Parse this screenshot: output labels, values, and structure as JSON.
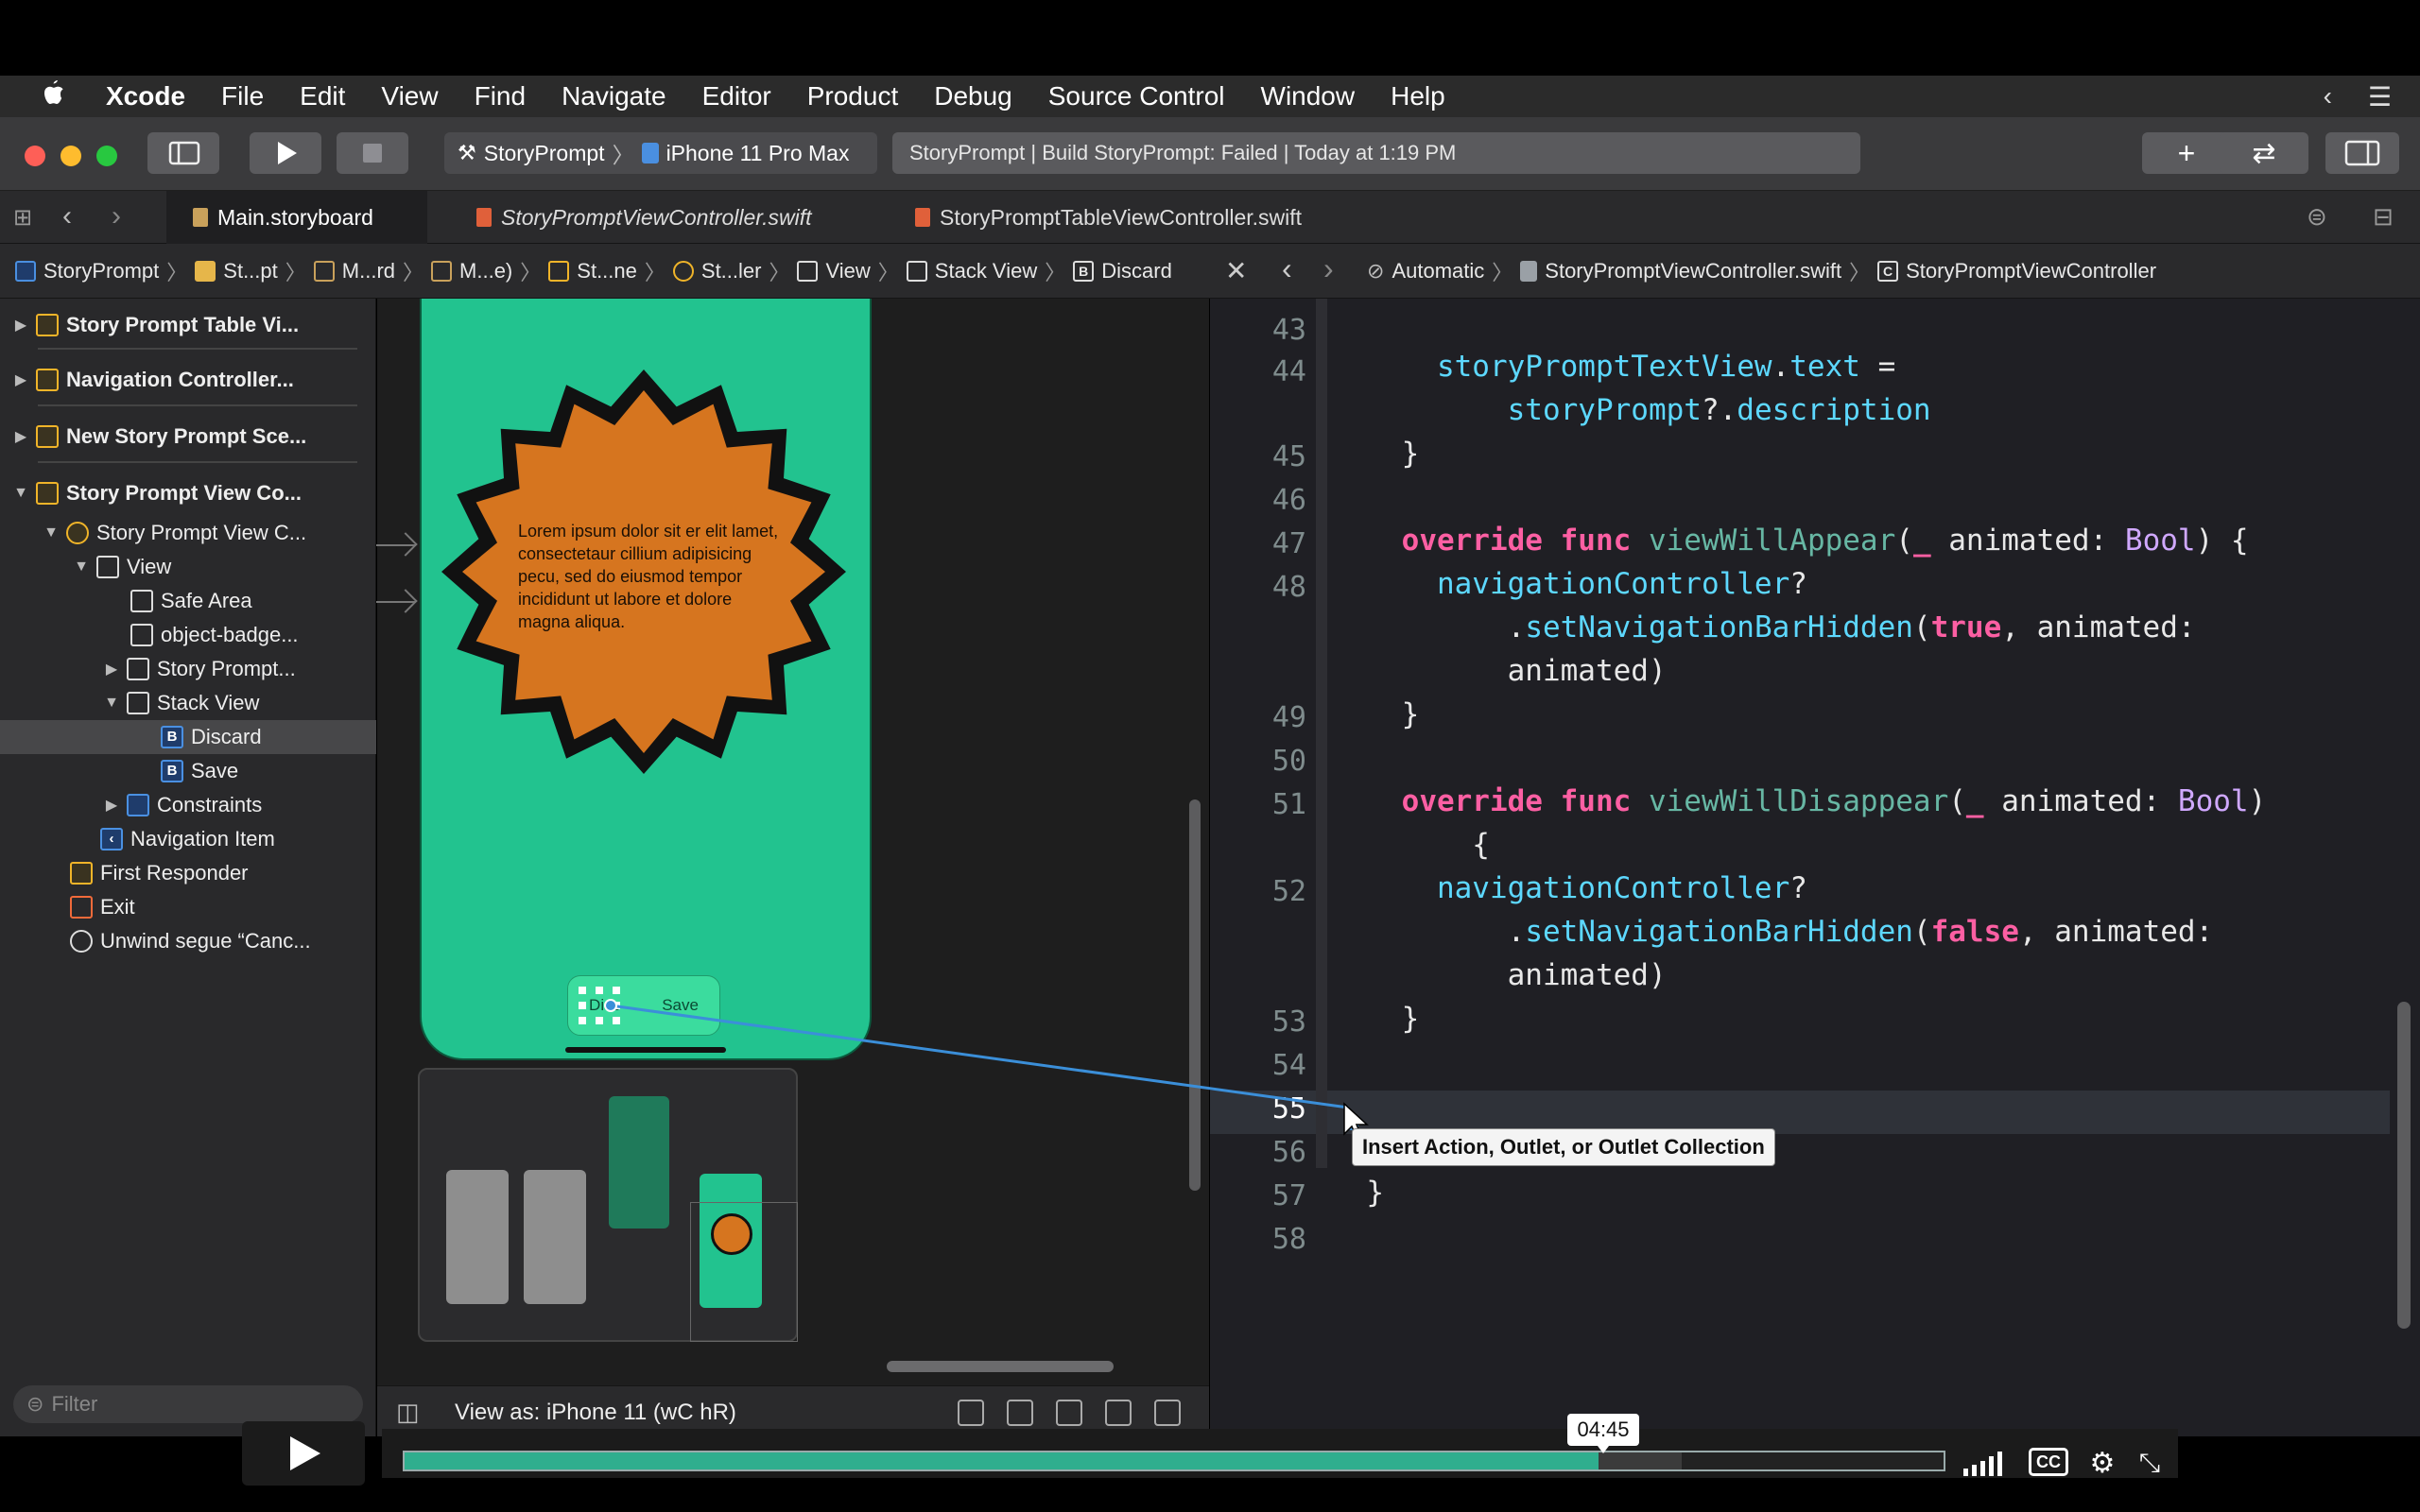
{
  "menubar": {
    "apple": "",
    "app": "Xcode",
    "items": [
      "File",
      "Edit",
      "View",
      "Find",
      "Navigate",
      "Editor",
      "Product",
      "Debug",
      "Source Control",
      "Window",
      "Help"
    ]
  },
  "toolbar": {
    "scheme": "StoryPrompt",
    "device": "iPhone 11 Pro Max",
    "status": "StoryPrompt | Build StoryPrompt: Failed | Today at 1:19 PM",
    "plus": "+",
    "swap": "⇄"
  },
  "tabs": [
    "Main.storyboard",
    "StoryPromptViewController.swift",
    "StoryPromptTableViewController.swift"
  ],
  "jumpbar_left": [
    "StoryPrompt",
    "St...pt",
    "M...rd",
    "M...e)",
    "St...ne",
    "St...ler",
    "View",
    "Stack View",
    "Discard"
  ],
  "jumpbar_right": [
    "Automatic",
    "StoryPromptViewController.swift",
    "StoryPromptViewController"
  ],
  "outline": [
    {
      "label": "Story Prompt Table Vi...",
      "bold": true
    },
    {
      "label": "Navigation Controller...",
      "bold": true
    },
    {
      "label": "New Story Prompt Sce...",
      "bold": true
    },
    {
      "label": "Story Prompt View Co...",
      "bold": true
    },
    {
      "label": "Story Prompt View C..."
    },
    {
      "label": "View"
    },
    {
      "label": "Safe Area"
    },
    {
      "label": "object-badge..."
    },
    {
      "label": "Story Prompt..."
    },
    {
      "label": "Stack View"
    },
    {
      "label": "Discard"
    },
    {
      "label": "Save"
    },
    {
      "label": "Constraints"
    },
    {
      "label": "Navigation Item"
    },
    {
      "label": "First Responder"
    },
    {
      "label": "Exit"
    },
    {
      "label": "Unwind segue “Canc..."
    }
  ],
  "filter_placeholder": "Filter",
  "canvas": {
    "lorem": "Lorem ipsum dolor sit er elit lamet, consectetaur cillium adipisicing pecu, sed do eiusmod tempor incididunt ut labore et dolore magna aliqua.",
    "stack_discard": "Disc",
    "stack_save": "Save",
    "view_as": "View as: iPhone 11 (wC hR)"
  },
  "code": {
    "line_numbers": [
      "43",
      "44",
      "",
      "45",
      "46",
      "47",
      "48",
      "",
      "",
      "49",
      "50",
      "51",
      "",
      "52",
      "",
      "",
      "53",
      "54",
      "55",
      "56",
      "57",
      "58"
    ],
    "current_line": "55",
    "tooltip": "Insert Action, Outlet, or Outlet Collection"
  },
  "player": {
    "time": "04:45",
    "progress": 0.776,
    "buffered": 0.83,
    "cc": "CC"
  },
  "colors": {
    "phone_bg": "#22c38f",
    "badge_fill": "#d6751f",
    "accent_link": "#3b8fd9",
    "progress": "#2fae8e"
  }
}
